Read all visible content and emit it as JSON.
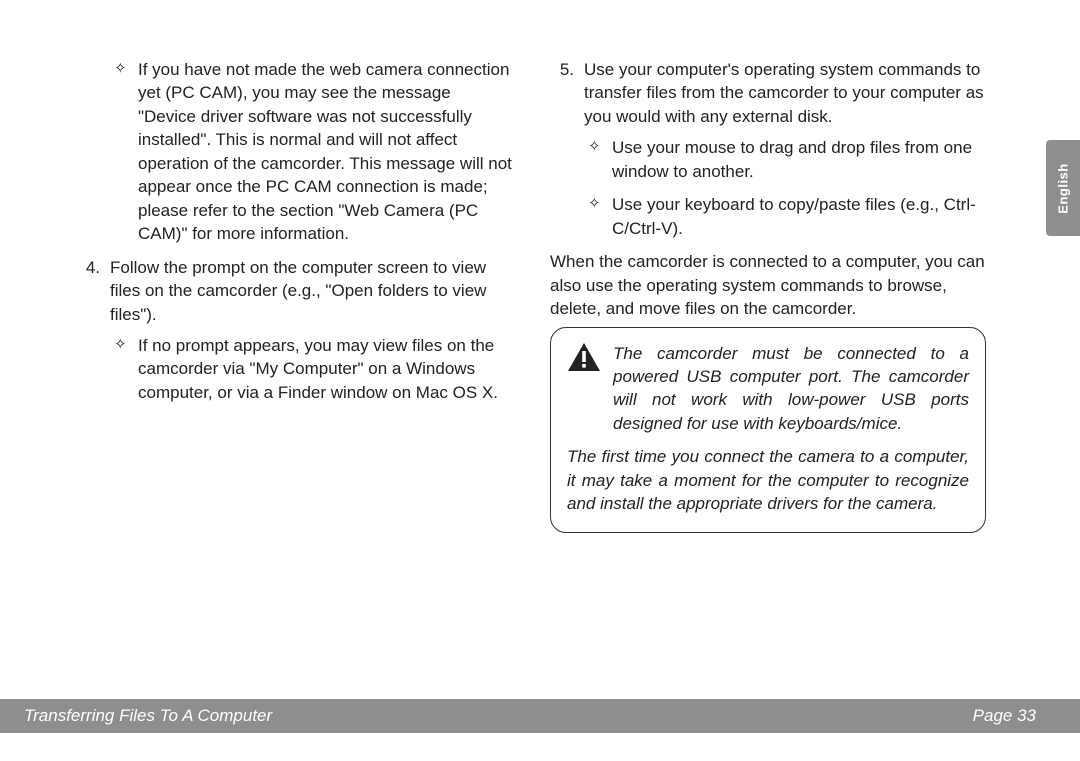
{
  "left_col": {
    "diamond1": "If you have not made the web camera connection yet (PC CAM), you may see the message \"Device driver software was not successfully installed\". This is normal and will not affect operation of the camcorder. This message will not appear once the PC CAM connection is made; please refer to the section \"Web Camera (PC CAM)\" for more information.",
    "item4_num": "4.",
    "item4_text": "Follow the prompt on the computer screen to view files on the camcorder (e.g., \"Open folders to view files\").",
    "diamond2": "If no prompt appears, you may view files on the camcorder via \"My Computer\" on a Windows computer, or via a Finder window on Mac OS X."
  },
  "right_col": {
    "item5_num": "5.",
    "item5_text": "Use your computer's operating system commands to transfer files from the camcorder to your computer as you would with any external disk.",
    "diamond1": "Use your mouse to drag and drop files from one window to another.",
    "diamond2": "Use your keyboard to copy/paste files (e.g., Ctrl-C/Ctrl-V).",
    "para": "When the camcorder is connected to a computer, you can also use the operating system commands to browse, delete, and move files on the camcorder.",
    "note1": "The camcorder must be connected to a powered USB computer port. The camcorder will not work with low-power USB ports designed for use with keyboards/mice.",
    "note2": "The first time you connect the camera to a computer, it may take a moment for the computer to recognize and install the appropriate drivers for the camera."
  },
  "footer": {
    "left": "Transferring Files To A Computer",
    "right": "Page 33"
  },
  "lang_tab": "English"
}
